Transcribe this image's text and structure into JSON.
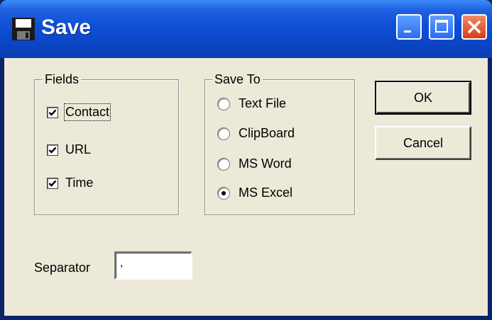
{
  "window": {
    "title": "Save"
  },
  "fields": {
    "label": "Fields",
    "items": [
      {
        "label": "Contact",
        "checked": true
      },
      {
        "label": "URL",
        "checked": true
      },
      {
        "label": "Time",
        "checked": true
      }
    ]
  },
  "save_to": {
    "label": "Save To",
    "options": [
      {
        "label": "Text File",
        "selected": false
      },
      {
        "label": "ClipBoard",
        "selected": false
      },
      {
        "label": "MS Word",
        "selected": false
      },
      {
        "label": "MS Excel",
        "selected": true
      }
    ]
  },
  "buttons": {
    "ok": "OK",
    "cancel": "Cancel"
  },
  "separator": {
    "label": "Separator",
    "value": ","
  }
}
